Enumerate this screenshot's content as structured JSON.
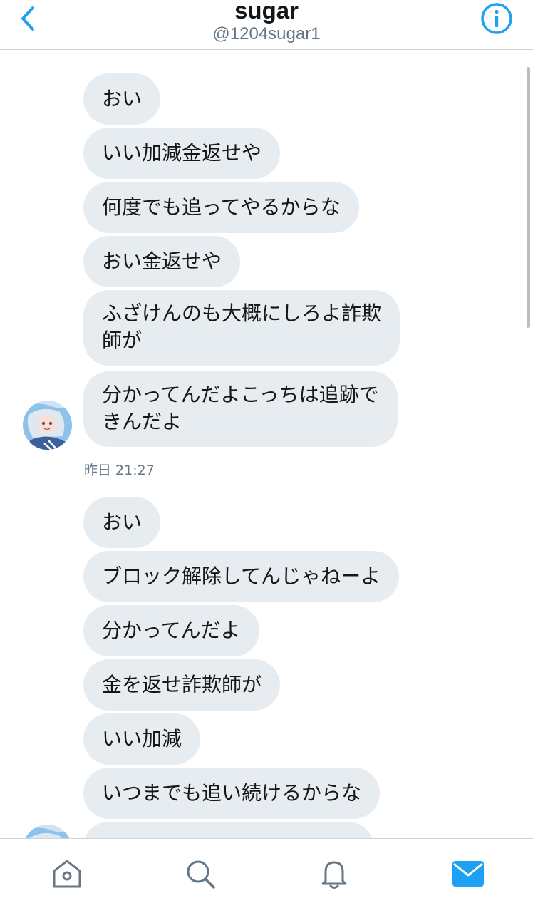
{
  "header": {
    "title": "sugar",
    "handle": "@1204sugar1"
  },
  "colors": {
    "accent": "#1da1f2",
    "bubble": "#e6ecf0",
    "secondary_text": "#657786"
  },
  "conversation": {
    "group1": {
      "messages": [
        "おい",
        "いい加減金返せや",
        "何度でも追ってやるからな",
        "おい金返せや",
        "ふざけんのも大概にしろよ詐欺\n師が",
        "分かってんだよこっちは追跡で\nきんだよ"
      ],
      "timestamp": "昨日 21:27"
    },
    "group2": {
      "messages": [
        "おい",
        "ブロック解除してんじゃねーよ",
        "分かってんだよ",
        "金を返せ詐欺師が",
        "いい加減",
        "いつまでも追い続けるからな"
      ]
    }
  },
  "tabbar": {
    "icons": [
      "home-icon",
      "search-icon",
      "notifications-icon",
      "messages-icon"
    ],
    "active": "messages-icon"
  }
}
